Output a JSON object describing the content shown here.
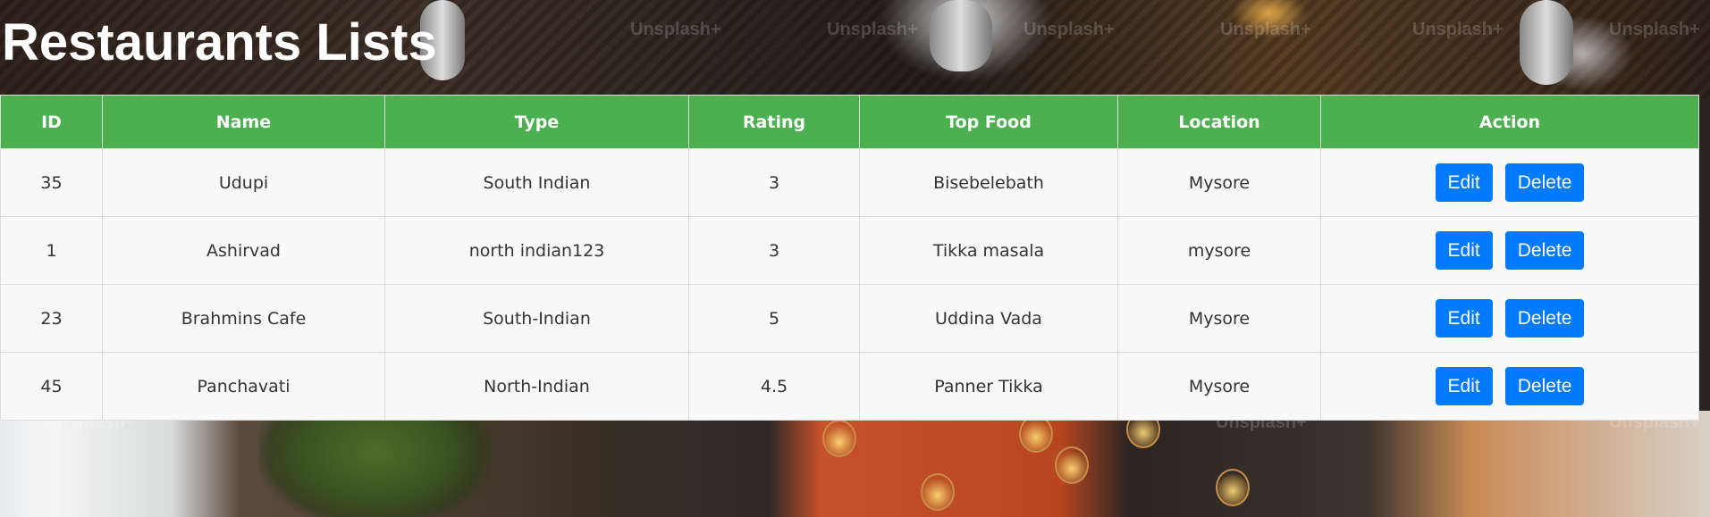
{
  "header": {
    "title": "Restaurants Lists"
  },
  "background": {
    "watermark": "Unsplash+"
  },
  "table": {
    "columns": [
      "ID",
      "Name",
      "Type",
      "Rating",
      "Top Food",
      "Location",
      "Action"
    ],
    "rows": [
      {
        "id": "35",
        "name": "Udupi",
        "type": "South Indian",
        "rating": "3",
        "top_food": "Bisebelebath",
        "location": "Mysore"
      },
      {
        "id": "1",
        "name": "Ashirvad",
        "type": "north indian123",
        "rating": "3",
        "top_food": "Tikka masala",
        "location": "mysore"
      },
      {
        "id": "23",
        "name": "Brahmins Cafe",
        "type": "South-Indian",
        "rating": "5",
        "top_food": "Uddina Vada",
        "location": "Mysore"
      },
      {
        "id": "45",
        "name": "Panchavati",
        "type": "North-Indian",
        "rating": "4.5",
        "top_food": "Panner Tikka",
        "location": "Mysore"
      }
    ],
    "edit_label": "Edit",
    "delete_label": "Delete"
  },
  "colors": {
    "header_green": "#4caf50",
    "button_blue": "#007bff",
    "row_background": "#f9f9f9"
  }
}
